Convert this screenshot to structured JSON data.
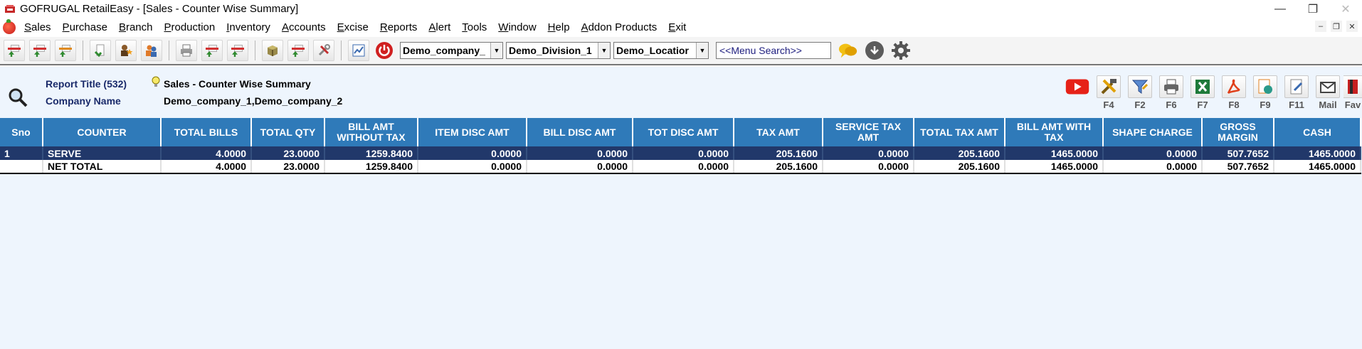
{
  "window": {
    "title": "GOFRUGAL RetailEasy - [Sales - Counter Wise Summary]",
    "minimize": "—",
    "restore": "❐",
    "close": "✕"
  },
  "menu": {
    "items": [
      "Sales",
      "Purchase",
      "Branch",
      "Production",
      "Inventory",
      "Accounts",
      "Excise",
      "Reports",
      "Alert",
      "Tools",
      "Window",
      "Help",
      "Addon Products",
      "Exit"
    ],
    "mdi": [
      "–",
      "❐",
      "✕"
    ]
  },
  "toolbar": {
    "company": "Demo_company_",
    "division": "Demo_Division_1",
    "location": "Demo_Locatior",
    "search_placeholder": "<<Menu Search>>"
  },
  "report": {
    "title_label": "Report Title (532)",
    "title_value": "Sales - Counter Wise Summary",
    "company_label": "Company Name",
    "company_value": "Demo_company_1,Demo_company_2",
    "icon_keys": [
      "",
      "F4",
      "F2",
      "F6",
      "F7",
      "F8",
      "F9",
      "F11",
      "Mail",
      "Fav"
    ]
  },
  "table": {
    "columns": [
      "Sno",
      "COUNTER",
      "TOTAL BILLS",
      "TOTAL QTY",
      "BILL AMT WITHOUT TAX",
      "ITEM DISC AMT",
      "BILL DISC AMT",
      "TOT DISC AMT",
      "TAX AMT",
      "SERVICE TAX AMT",
      "TOTAL TAX AMT",
      "BILL AMT WITH TAX",
      "SHAPE CHARGE",
      "GROSS MARGIN",
      "CASH"
    ],
    "rows": [
      [
        "1",
        "SERVE",
        "4.0000",
        "23.0000",
        "1259.8400",
        "0.0000",
        "0.0000",
        "0.0000",
        "205.1600",
        "0.0000",
        "205.1600",
        "1465.0000",
        "0.0000",
        "507.7652",
        "1465.0000"
      ]
    ],
    "total": [
      "",
      "NET TOTAL",
      "4.0000",
      "23.0000",
      "1259.8400",
      "0.0000",
      "0.0000",
      "0.0000",
      "205.1600",
      "0.0000",
      "205.1600",
      "1465.0000",
      "0.0000",
      "507.7652",
      "1465.0000"
    ]
  },
  "colors": {
    "header_bg": "#2f7ab9",
    "selected_row": "#21386a",
    "report_bg": "#eef5fd"
  }
}
